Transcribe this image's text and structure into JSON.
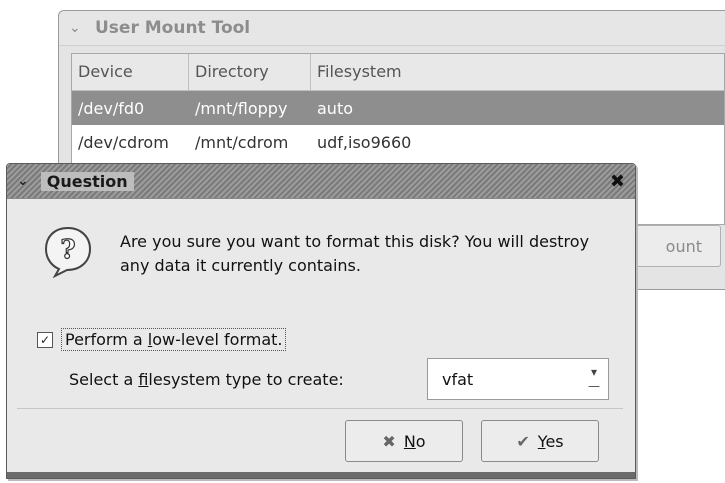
{
  "bg_window": {
    "title": "User Mount Tool",
    "columns": [
      "Device",
      "Directory",
      "Filesystem"
    ],
    "rows": [
      {
        "device": "/dev/fd0",
        "directory": "/mnt/floppy",
        "filesystem": "auto",
        "selected": true
      },
      {
        "device": "/dev/cdrom",
        "directory": "/mnt/cdrom",
        "filesystem": "udf,iso9660",
        "selected": false
      }
    ],
    "mount_button_partial": "ount"
  },
  "dialog": {
    "title": "Question",
    "message": "Are you sure you want to format this disk?  You will destroy any data it currently contains.",
    "lowlevel_pre": "Perform a ",
    "lowlevel_mnemonic": "l",
    "lowlevel_post": "ow-level format.",
    "fs_pre": "Select a ",
    "fs_mnemonic": "f",
    "fs_post": "ilesystem type to create:",
    "fs_value": "vfat",
    "no_mnemonic": "N",
    "no_rest": "o",
    "yes_mnemonic": "Y",
    "yes_rest": "es",
    "checkbox_checked": true
  },
  "icons": {
    "question": "question-icon",
    "no": "cross-icon",
    "yes": "check-icon"
  }
}
